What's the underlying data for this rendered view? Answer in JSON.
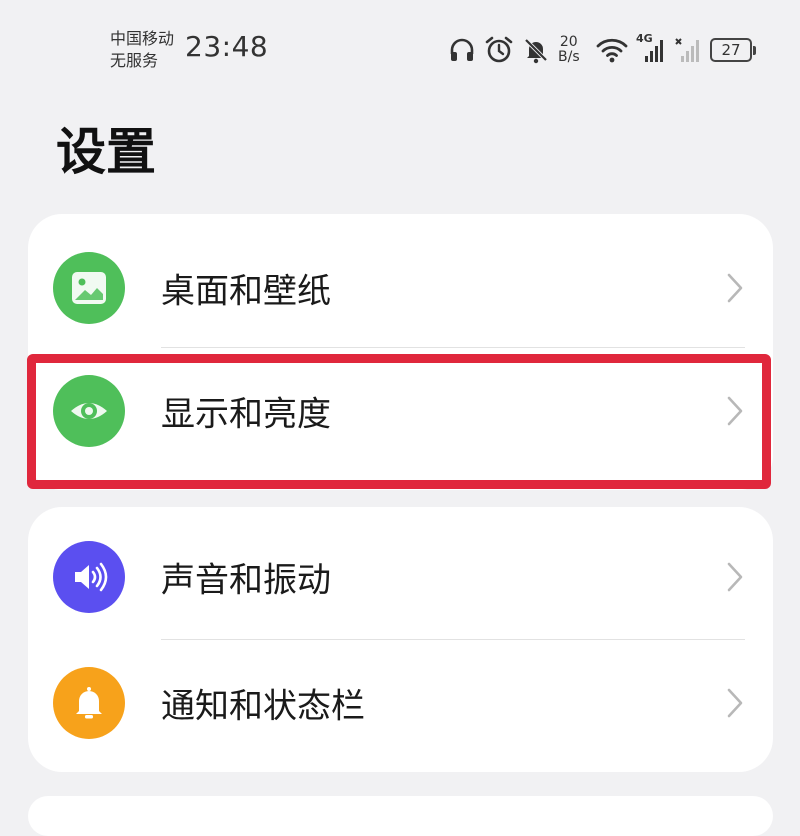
{
  "status_bar": {
    "carrier": "中国移动",
    "service": "无服务",
    "time": "23:48",
    "net_speed_value": "20",
    "net_speed_unit": "B/s",
    "network_type": "4G",
    "battery": "27",
    "icons": [
      "headphones-icon",
      "alarm-icon",
      "mute-bell-icon",
      "wifi-icon",
      "signal-4g-icon",
      "no-signal-icon",
      "battery-icon"
    ]
  },
  "page": {
    "title": "设置"
  },
  "groups": [
    {
      "items": [
        {
          "label": "桌面和壁纸",
          "icon": "wallpaper-icon",
          "color": "#4fbf5a"
        },
        {
          "label": "显示和亮度",
          "icon": "eye-icon",
          "color": "#4fbf5a",
          "highlighted": true
        }
      ]
    },
    {
      "items": [
        {
          "label": "声音和振动",
          "icon": "speaker-icon",
          "color": "#5b4ff0"
        },
        {
          "label": "通知和状态栏",
          "icon": "bell-icon",
          "color": "#f7a21b"
        }
      ]
    }
  ],
  "highlight_color": "#e0273c"
}
